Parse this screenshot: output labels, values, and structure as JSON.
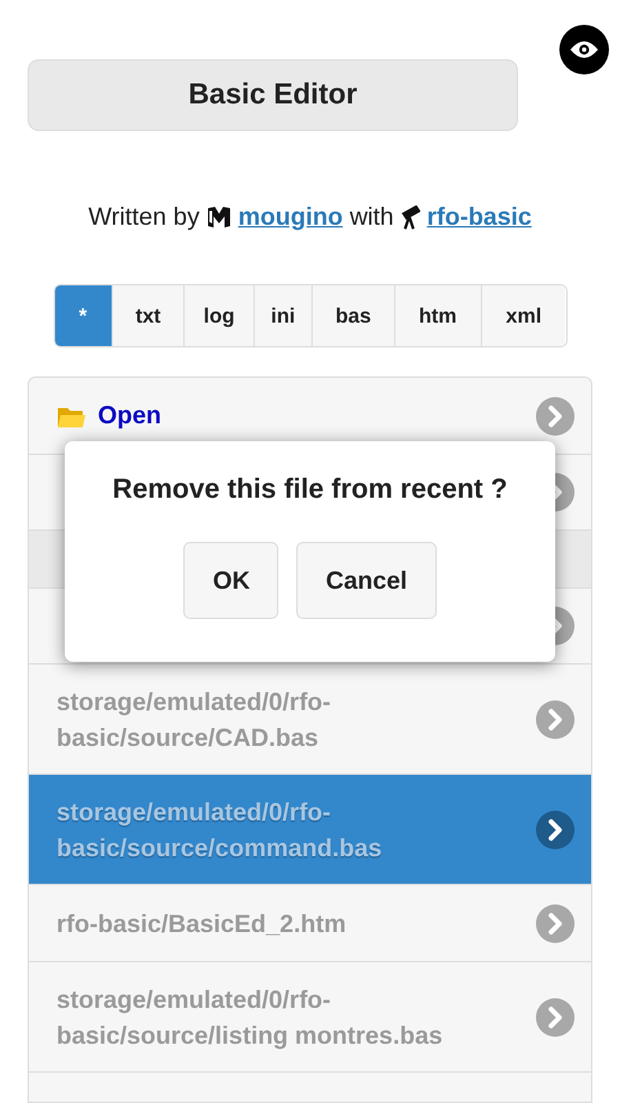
{
  "header": {
    "title": "Basic Editor"
  },
  "credits": {
    "prefix": "Written by",
    "author": "mougino",
    "middle": "with",
    "tool": "rfo-basic"
  },
  "filters": [
    {
      "label": "*",
      "selected": true
    },
    {
      "label": "txt",
      "selected": false
    },
    {
      "label": "log",
      "selected": false
    },
    {
      "label": "ini",
      "selected": false
    },
    {
      "label": "bas",
      "selected": false
    },
    {
      "label": "htm",
      "selected": false
    },
    {
      "label": "xml",
      "selected": false
    }
  ],
  "list": [
    {
      "kind": "open",
      "label": "Open",
      "selected": false
    },
    {
      "kind": "hidden",
      "selected": false
    },
    {
      "kind": "divider"
    },
    {
      "kind": "hidden",
      "selected": false
    },
    {
      "kind": "file",
      "label": "storage/emulated/0/rfo-basic/source/CAD.bas",
      "selected": false
    },
    {
      "kind": "file",
      "label": "storage/emulated/0/rfo-basic/source/command.bas",
      "selected": true
    },
    {
      "kind": "file",
      "label": "rfo-basic/BasicEd_2.htm",
      "selected": false
    },
    {
      "kind": "file",
      "label": "storage/emulated/0/rfo-basic/source/listing montres.bas",
      "selected": false
    },
    {
      "kind": "cut",
      "selected": false
    }
  ],
  "dialog": {
    "message": "Remove this file from recent ?",
    "buttons": [
      "OK",
      "Cancel"
    ]
  }
}
